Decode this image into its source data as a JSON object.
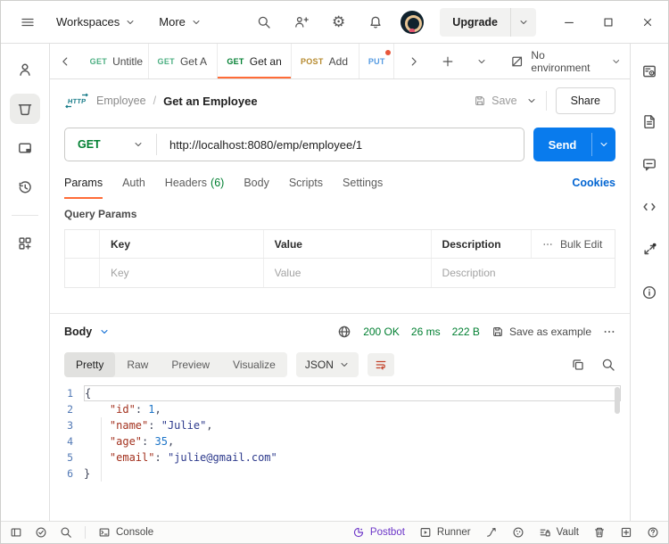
{
  "colors": {
    "accent_orange": "#ff6c37",
    "send_blue": "#097bed",
    "success_green": "#007f31",
    "link_blue": "#0265d2",
    "method_get": "#007f31",
    "method_post": "#b68a2e",
    "method_put": "#569be2",
    "postbot_purple": "#6c35c8"
  },
  "titlebar": {
    "workspaces": "Workspaces",
    "more": "More",
    "upgrade": "Upgrade"
  },
  "tabstrip": {
    "tabs": [
      {
        "method": "GET",
        "title": "Untitle"
      },
      {
        "method": "GET",
        "title": "Get A"
      },
      {
        "method": "GET",
        "title": "Get an"
      },
      {
        "method": "POST",
        "title": "Add"
      },
      {
        "method": "PUT",
        "title": ""
      }
    ],
    "environment_selector": "No environment"
  },
  "request": {
    "collection": "Employee",
    "breadcrumb_separator": "/",
    "name": "Get an Employee",
    "save": "Save",
    "share": "Share",
    "method": "GET",
    "url": "http://localhost:8080/emp/employee/1",
    "send": "Send",
    "tabs": {
      "params": "Params",
      "auth": "Auth",
      "headers": "Headers",
      "headers_count": "(6)",
      "body": "Body",
      "scripts": "Scripts",
      "settings": "Settings"
    },
    "cookies_link": "Cookies",
    "query_params": {
      "title": "Query Params",
      "columns": [
        "Key",
        "Value",
        "Description"
      ],
      "bulk_edit": "Bulk Edit",
      "placeholder_row": {
        "key": "Key",
        "value": "Value",
        "description": "Description"
      }
    }
  },
  "response": {
    "body_label": "Body",
    "status": "200 OK",
    "time": "26 ms",
    "size": "222 B",
    "save_as_example": "Save as example",
    "views": {
      "pretty": "Pretty",
      "raw": "Raw",
      "preview": "Preview",
      "visualize": "Visualize"
    },
    "format": "JSON",
    "json_pretty": {
      "id": 1,
      "name": "Julie",
      "age": 35,
      "email": "julie@gmail.com"
    },
    "code": {
      "line_numbers": [
        "1",
        "2",
        "3",
        "4",
        "5",
        "6"
      ],
      "l1": "{",
      "l2_key": "\"id\"",
      "l2_sep": ": ",
      "l2_num": "1",
      "l2_comma": ",",
      "l3_key": "\"name\"",
      "l3_sep": ": ",
      "l3_str": "\"Julie\"",
      "l3_comma": ",",
      "l4_key": "\"age\"",
      "l4_sep": ": ",
      "l4_num": "35",
      "l4_comma": ",",
      "l5_key": "\"email\"",
      "l5_sep": ": ",
      "l5_str": "\"julie@gmail.com\"",
      "l6": "}"
    }
  },
  "footer": {
    "console": "Console",
    "postbot": "Postbot",
    "runner": "Runner",
    "vault": "Vault"
  }
}
